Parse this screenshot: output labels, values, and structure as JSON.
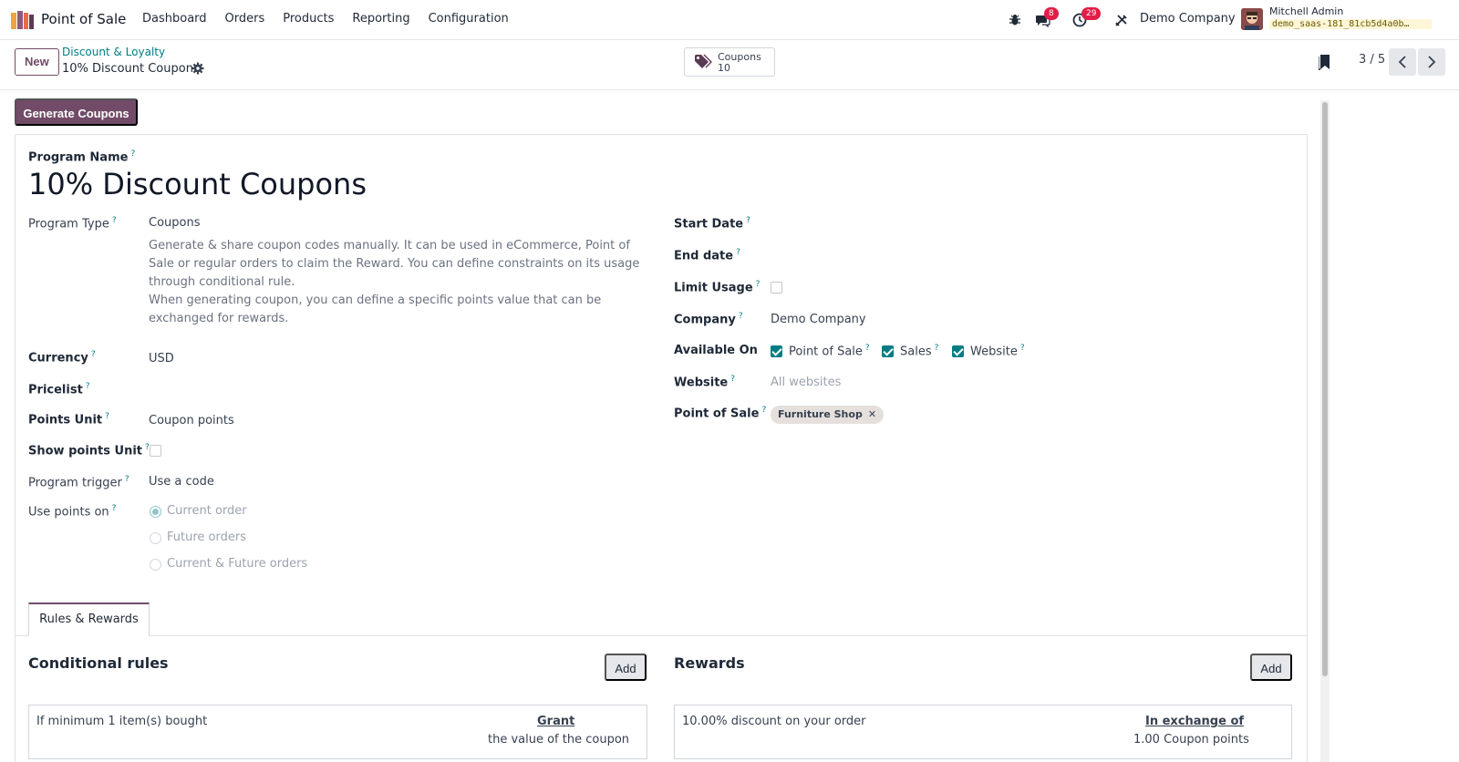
{
  "navbar": {
    "app_name": "Point of Sale",
    "menu": [
      "Dashboard",
      "Orders",
      "Products",
      "Reporting",
      "Configuration"
    ],
    "messages_count": "8",
    "activities_count": "29",
    "company": "Demo Company",
    "user_name": "Mitchell Admin",
    "db_name": "demo_saas-181_81cb5d4a0b…"
  },
  "control_panel": {
    "new_label": "New",
    "breadcrumb_parent": "Discount & Loyalty",
    "breadcrumb_current": "10% Discount Coupons",
    "smart_button_label": "Coupons",
    "smart_button_count": "10",
    "pager": "3 / 5"
  },
  "form": {
    "generate_label": "Generate Coupons",
    "program_name_label": "Program Name",
    "program_name": "10% Discount Coupons",
    "program_type_label": "Program Type",
    "program_type": "Coupons",
    "program_type_desc_1": "Generate & share coupon codes manually. It can be used in eCommerce, Point of Sale or regular orders to claim the Reward. You can define constraints on its usage through conditional rule.",
    "program_type_desc_2": "When generating coupon, you can define a specific points value that can be exchanged for rewards.",
    "currency_label": "Currency",
    "currency": "USD",
    "pricelist_label": "Pricelist",
    "points_unit_label": "Points Unit",
    "points_unit": "Coupon points",
    "show_points_unit_label": "Show points Unit",
    "program_trigger_label": "Program trigger",
    "program_trigger": "Use a code",
    "use_points_on_label": "Use points on",
    "use_points_options": [
      "Current order",
      "Future orders",
      "Current & Future orders"
    ],
    "use_points_selected": "Current order",
    "start_date_label": "Start Date",
    "end_date_label": "End date",
    "limit_usage_label": "Limit Usage",
    "company_label": "Company",
    "company": "Demo Company",
    "available_on_label": "Available On",
    "available_on": [
      {
        "label": "Point of Sale",
        "checked": true
      },
      {
        "label": "Sales",
        "checked": true
      },
      {
        "label": "Website",
        "checked": true
      }
    ],
    "website_label": "Website",
    "website_placeholder": "All websites",
    "pos_label": "Point of Sale",
    "pos_tag": "Furniture Shop"
  },
  "tabs": {
    "rules_rewards": "Rules & Rewards"
  },
  "rules": {
    "title": "Conditional rules",
    "add_label": "Add",
    "row_text": "If minimum 1 item(s) bought",
    "grant_label": "Grant",
    "grant_value": "the value of the coupon"
  },
  "rewards": {
    "title": "Rewards",
    "add_label": "Add",
    "row_text": "10.00% discount on your order",
    "exchange_label": "In exchange of",
    "exchange_value": "1.00 Coupon points"
  },
  "colors": {
    "brand": "#714B67",
    "accent": "#017e84",
    "badge": "#e11d48"
  }
}
